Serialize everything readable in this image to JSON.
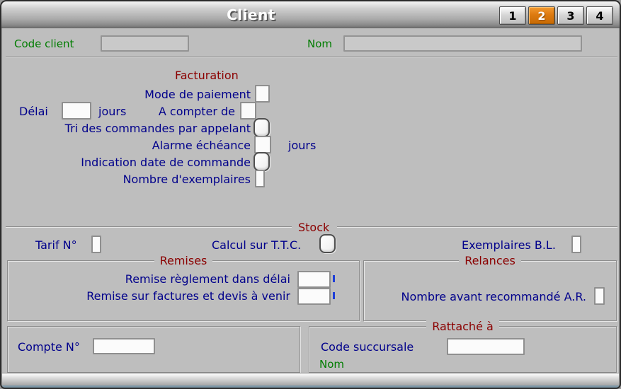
{
  "window": {
    "title": "Client"
  },
  "tabs": {
    "active_index": 1,
    "items": [
      {
        "label": "1"
      },
      {
        "label": "2"
      },
      {
        "label": "3"
      },
      {
        "label": "4"
      }
    ]
  },
  "colors": {
    "background": "#bebebe",
    "tab_active_orange": "#dd7a10",
    "field_label_blue": "#00008b",
    "section_title_red": "#8b0000",
    "key_label_green": "#007d00"
  },
  "header": {
    "code_client": {
      "label": "Code client",
      "value": ""
    },
    "nom": {
      "label": "Nom",
      "value": ""
    }
  },
  "facturation": {
    "title": "Facturation",
    "mode_paiement": {
      "label": "Mode de paiement",
      "value": ""
    },
    "delai": {
      "label": "Délai",
      "value": "",
      "suffix": "jours"
    },
    "a_compter_de": {
      "label": "A compter de",
      "value": ""
    },
    "tri_commandes": {
      "label": "Tri des commandes par appelant",
      "checked": false
    },
    "alarme_echeance": {
      "label": "Alarme échéance",
      "value": "",
      "suffix": "jours"
    },
    "indication_date": {
      "label": "Indication date de commande",
      "checked": false
    },
    "nb_exemplaires": {
      "label": "Nombre d'exemplaires",
      "value": ""
    }
  },
  "stock": {
    "title": "Stock",
    "tarif": {
      "label": "Tarif N°",
      "value": ""
    },
    "calcul_ttc": {
      "label": "Calcul sur T.T.C.",
      "checked": false
    },
    "exemplaires_bl": {
      "label": "Exemplaires B.L.",
      "value": ""
    }
  },
  "remises": {
    "title": "Remises",
    "remise_reglement": {
      "label": "Remise règlement dans délai",
      "value": ""
    },
    "remise_factures": {
      "label": "Remise sur factures et devis à venir",
      "value": ""
    }
  },
  "relances": {
    "title": "Relances",
    "nombre_avant_ar": {
      "label": "Nombre avant recommandé A.R.",
      "value": ""
    }
  },
  "comptabilite": {
    "compte": {
      "label": "Compte N°",
      "value": ""
    }
  },
  "rattache": {
    "title": "Rattaché à",
    "code_succursale": {
      "label": "Code succursale",
      "value": ""
    },
    "nom": {
      "label": "Nom",
      "value": ""
    }
  }
}
